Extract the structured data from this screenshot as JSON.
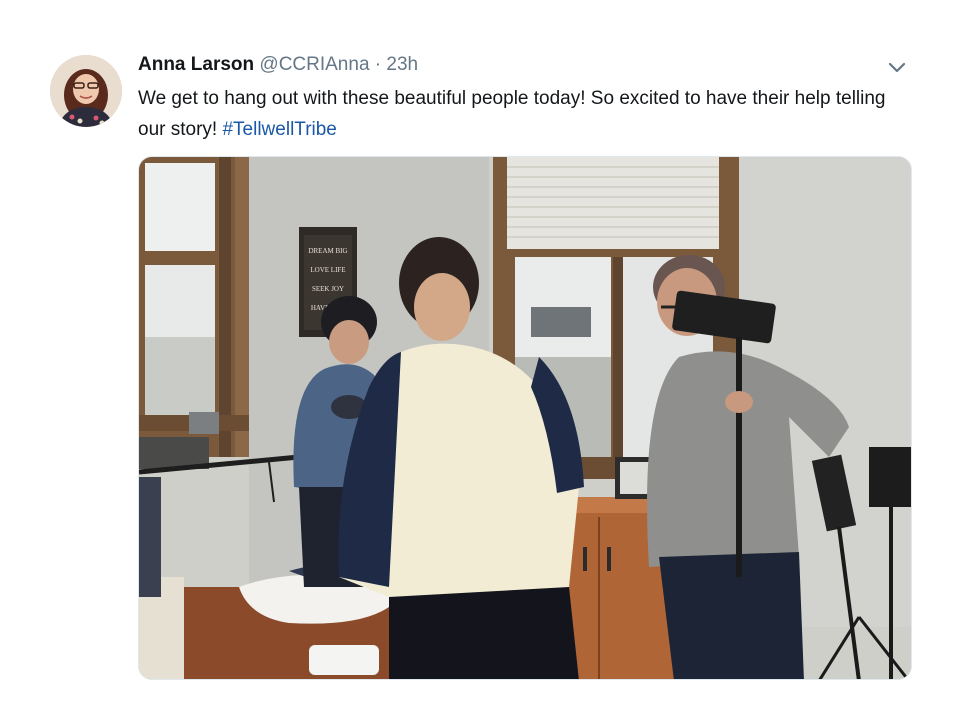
{
  "tweet": {
    "author_name": "Anna Larson",
    "handle": "@CCRIAnna",
    "separator": "·",
    "time": "23h",
    "text": "We get to hang out with these beautiful people today! So excited to have their help telling our story! ",
    "hashtag": "#TellwellTribe",
    "avatar_icon": "profile-photo",
    "caret_icon": "chevron-down-icon",
    "photo_sign_text": [
      "DREAM BIG",
      "LOVE LIFE",
      "SEEK JOY",
      "HAVE FUN"
    ]
  },
  "colors": {
    "name": "#14171a",
    "secondary": "#657786",
    "hashtag": "#1b57a8",
    "background": "#ffffff"
  }
}
